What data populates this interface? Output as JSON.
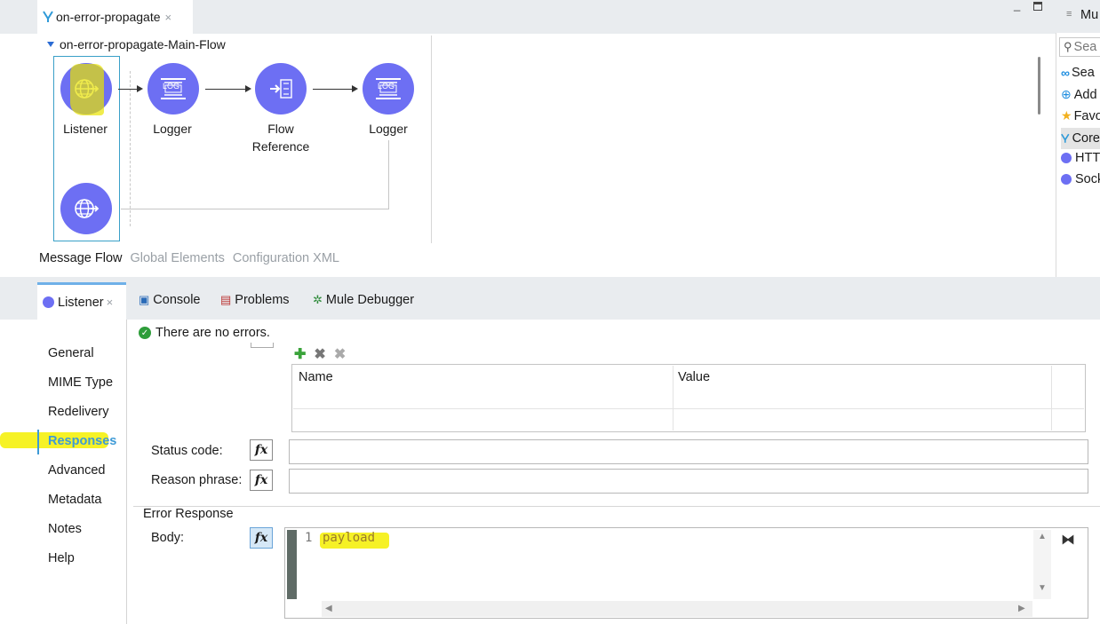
{
  "editor": {
    "tab_title": "on-error-propagate",
    "tab_close": "×",
    "flow_name": "on-error-propagate-Main-Flow",
    "nodes": [
      {
        "label": "Listener",
        "icon": "http-listener-icon"
      },
      {
        "label": "Logger",
        "icon": "logger-icon"
      },
      {
        "label": "Flow\nReference",
        "icon": "flow-reference-icon"
      },
      {
        "label": "Logger",
        "icon": "logger-icon"
      }
    ],
    "log_text": "LOG",
    "subtabs": [
      "Message Flow",
      "Global Elements",
      "Configuration XML"
    ]
  },
  "palette": {
    "header": "Mu",
    "search_placeholder": "Sea",
    "items": [
      {
        "label": "Sea",
        "icon": "exchange-icon"
      },
      {
        "label": "Add",
        "icon": "add-modules-icon"
      },
      {
        "label": "Favo",
        "icon": "star-icon"
      },
      {
        "label": "Core",
        "icon": "mule-icon"
      },
      {
        "label": "HTT",
        "icon": "module-dot-icon"
      },
      {
        "label": "Sock",
        "icon": "module-dot-icon"
      }
    ]
  },
  "bottom": {
    "props_tab": "Listener",
    "props_close": "×",
    "views": [
      "Console",
      "Problems",
      "Mule Debugger"
    ],
    "status": "There are no errors.",
    "nav": [
      "General",
      "MIME Type",
      "Redelivery",
      "Responses",
      "Advanced",
      "Metadata",
      "Notes",
      "Help"
    ],
    "grid_headers": [
      "Name",
      "Value"
    ],
    "fields": {
      "status_code_label": "Status code:",
      "reason_phrase_label": "Reason phrase:",
      "status_code_value": "",
      "reason_phrase_value": ""
    },
    "fx_label": "fx",
    "error_response": {
      "legend": "Error Response",
      "body_label": "Body:",
      "line_number": "1",
      "code": "payload"
    }
  },
  "colors": {
    "node": "#6d6ff3",
    "accent_blue": "#3d9ad6",
    "highlight_yellow": "#f5f000"
  }
}
